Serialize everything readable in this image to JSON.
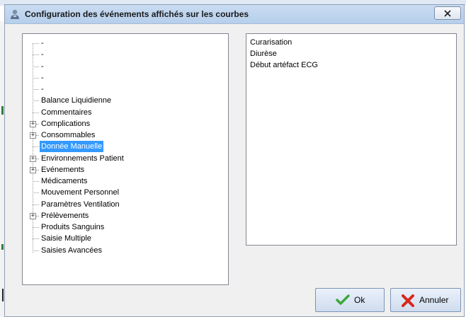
{
  "window": {
    "title": "Configuration des événements affichés sur les courbes"
  },
  "tree": {
    "items": [
      {
        "label": "-",
        "expandable": false,
        "selected": false
      },
      {
        "label": "-",
        "expandable": false,
        "selected": false
      },
      {
        "label": "-",
        "expandable": false,
        "selected": false
      },
      {
        "label": "-",
        "expandable": false,
        "selected": false
      },
      {
        "label": "-",
        "expandable": false,
        "selected": false
      },
      {
        "label": "Balance Liquidienne",
        "expandable": false,
        "selected": false
      },
      {
        "label": "Commentaires",
        "expandable": false,
        "selected": false
      },
      {
        "label": "Complications",
        "expandable": true,
        "selected": false
      },
      {
        "label": "Consommables",
        "expandable": true,
        "selected": false
      },
      {
        "label": "Donnée Manuelle",
        "expandable": false,
        "selected": true
      },
      {
        "label": "Environnements Patient",
        "expandable": true,
        "selected": false
      },
      {
        "label": "Evénements",
        "expandable": true,
        "selected": false
      },
      {
        "label": "Médicaments",
        "expandable": false,
        "selected": false
      },
      {
        "label": "Mouvement Personnel",
        "expandable": false,
        "selected": false
      },
      {
        "label": "Paramètres Ventilation",
        "expandable": false,
        "selected": false
      },
      {
        "label": "Prélèvements",
        "expandable": true,
        "selected": false
      },
      {
        "label": "Produits Sanguins",
        "expandable": false,
        "selected": false
      },
      {
        "label": "Saisie Multiple",
        "expandable": false,
        "selected": false
      },
      {
        "label": "Saisies Avancées",
        "expandable": false,
        "selected": false
      }
    ]
  },
  "list": {
    "items": [
      "Curarisation",
      "Diurèse",
      "Début artéfact ECG"
    ]
  },
  "buttons": {
    "ok_label": "Ok",
    "cancel_label": "Annuler"
  },
  "colors": {
    "selection": "#3399ff",
    "ok_check": "#3aa83a",
    "cancel_x": "#d9261c"
  },
  "icons": {
    "app": "app-icon",
    "close": "close-icon",
    "ok": "check-icon",
    "cancel": "x-icon",
    "expander": "plus-box-icon"
  }
}
